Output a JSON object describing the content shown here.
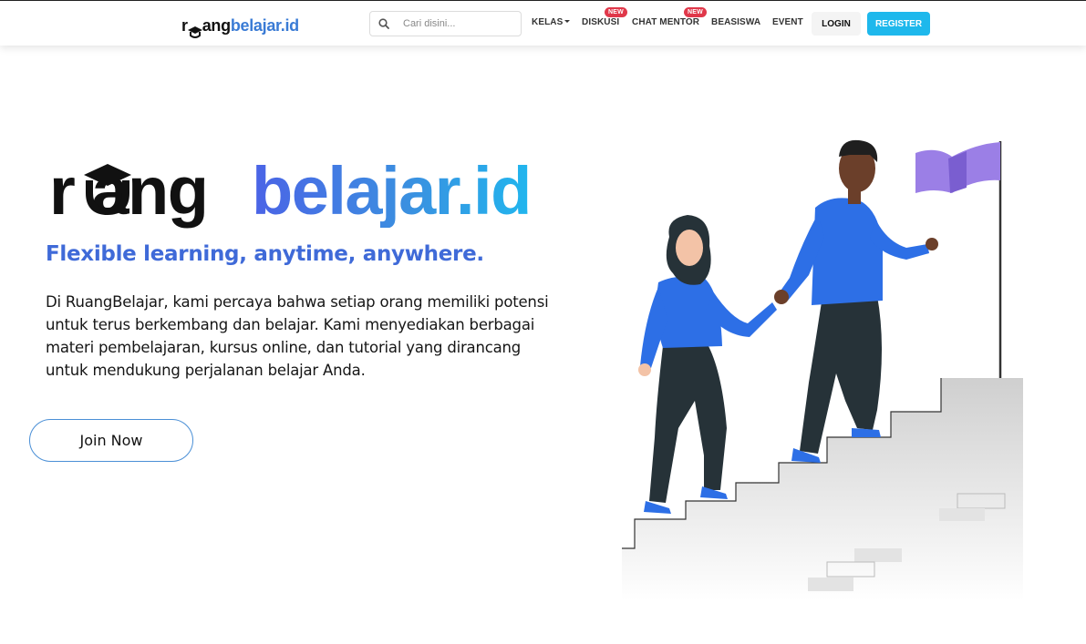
{
  "navbar": {
    "logo": {
      "dark": "r",
      "dark2": "ang",
      "blue": "belajar.id"
    },
    "search": {
      "placeholder": "Cari disini..."
    },
    "links": {
      "kelas": "KELAS",
      "diskusi": "DISKUSI",
      "chat_mentor": "CHAT MENTOR",
      "beasiswa": "BEASISWA",
      "event": "EVENT"
    },
    "badge_new": "NEW",
    "login": "LOGIN",
    "register": "REGISTER"
  },
  "hero": {
    "logo": {
      "dark": "r  ang",
      "blue": "belajar.id"
    },
    "tagline": "Flexible learning, anytime, anywhere.",
    "description": "Di RuangBelajar, kami percaya bahwa setiap orang memiliki potensi untuk terus berkembang dan belajar. Kami menyediakan berbagai materi pembelajaran, kursus online, dan tutorial yang dirancang untuk mendukung perjalanan belajar Anda.",
    "join_button": "Join Now"
  },
  "colors": {
    "brand_blue": "#3a7bd5",
    "tagline_blue": "#3f6ad8",
    "register_bg": "#1eb8ec",
    "badge_red": "#e0384a",
    "flag_purple": "#9b7fe6",
    "shirt_blue": "#2d6fe6"
  },
  "icons": [
    "search-icon",
    "graduation-cap-icon",
    "caret-down-icon"
  ]
}
